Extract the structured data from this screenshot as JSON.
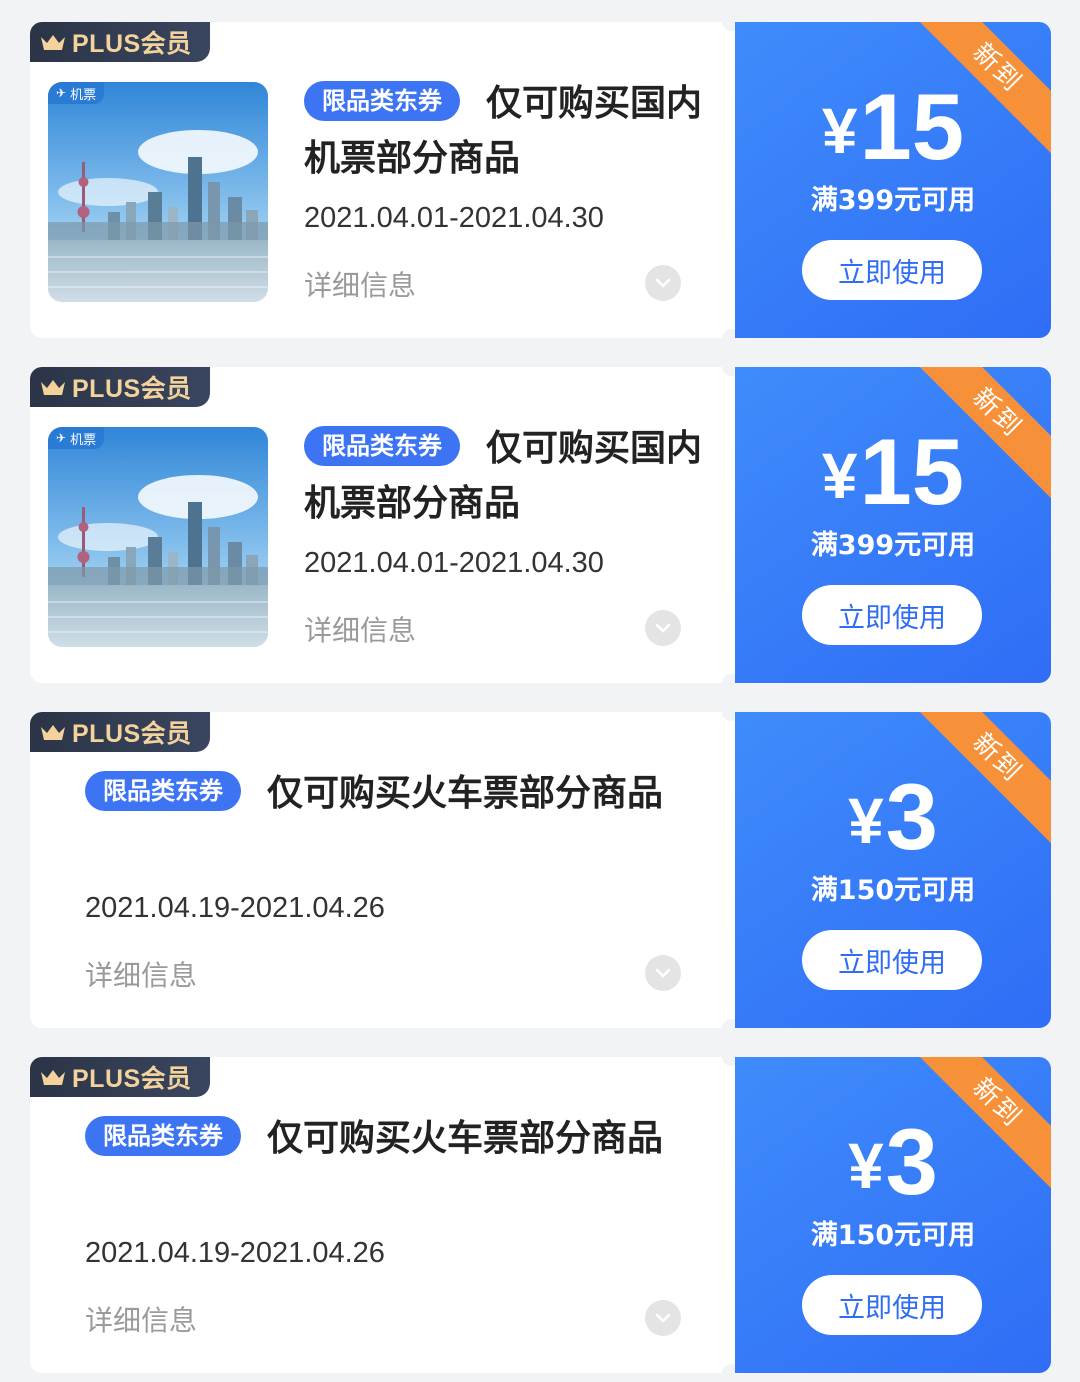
{
  "colors": {
    "background": "#f2f3f5",
    "accent_blue": "#3c74f3",
    "coupon_blue": "#2f6df6",
    "ribbon_orange": "#f69139",
    "plus_gold": "#f3d39b",
    "plus_dark": "#2b3446"
  },
  "coupons": [
    {
      "badge": "PLUS会员",
      "thumb_tag": "机票",
      "tag": "限品类东券",
      "title": "仅可购买国内机票部分商品",
      "date_range": "2021.04.01-2021.04.30",
      "detail_label": "详细信息",
      "ribbon": "新到",
      "currency": "¥",
      "amount": "15",
      "condition": "满399元可用",
      "button": "立即使用"
    },
    {
      "badge": "PLUS会员",
      "thumb_tag": "机票",
      "tag": "限品类东券",
      "title": "仅可购买国内机票部分商品",
      "date_range": "2021.04.01-2021.04.30",
      "detail_label": "详细信息",
      "ribbon": "新到",
      "currency": "¥",
      "amount": "15",
      "condition": "满399元可用",
      "button": "立即使用"
    },
    {
      "badge": "PLUS会员",
      "tag": "限品类东券",
      "title": "仅可购买火车票部分商品",
      "date_range": "2021.04.19-2021.04.26",
      "detail_label": "详细信息",
      "ribbon": "新到",
      "currency": "¥",
      "amount": "3",
      "condition": "满150元可用",
      "button": "立即使用"
    },
    {
      "badge": "PLUS会员",
      "tag": "限品类东券",
      "title": "仅可购买火车票部分商品",
      "date_range": "2021.04.19-2021.04.26",
      "detail_label": "详细信息",
      "ribbon": "新到",
      "currency": "¥",
      "amount": "3",
      "condition": "满150元可用",
      "button": "立即使用"
    }
  ]
}
